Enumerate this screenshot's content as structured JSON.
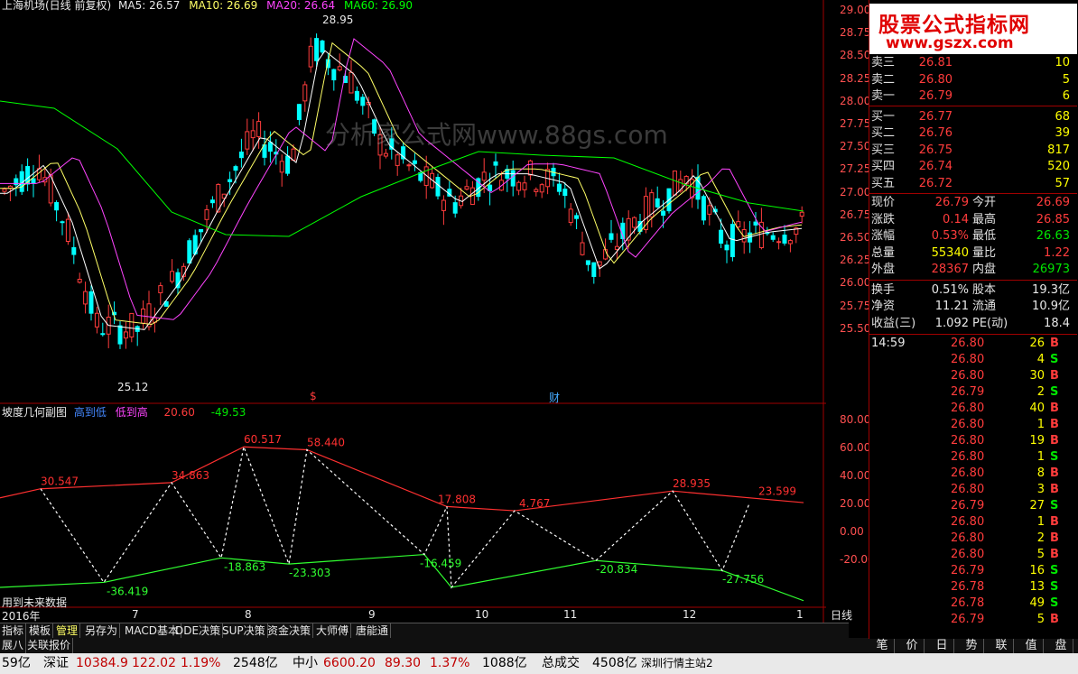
{
  "header": {
    "title": "上海机场(日线 前复权)",
    "ma5_label": "MA5: 26.57",
    "ma10_label": "MA10: 26.69",
    "ma20_label": "MA20: 26.64",
    "ma60_label": "MA60: 26.90"
  },
  "price_axis": [
    "29.00",
    "28.75",
    "28.50",
    "28.25",
    "28.00",
    "27.75",
    "27.50",
    "27.25",
    "27.00",
    "26.75",
    "26.50",
    "26.25",
    "26.00",
    "25.75",
    "25.50"
  ],
  "price_annotations": {
    "high": "28.95",
    "low": "25.12",
    "finance_marker": "财",
    "dollar_marker": "$"
  },
  "watermark_text": "分析家公式网www.88gs.com",
  "indicator": {
    "title": "坡度几何副图",
    "low_to_high": "高到低",
    "high_to_low": "低到高",
    "value1": "20.60",
    "value2": "-49.53",
    "axis": [
      "80.00",
      "60.00",
      "40.00",
      "20.00",
      "0.00",
      "-20.00"
    ],
    "labels": [
      "30.547",
      "34.863",
      "60.517",
      "58.440",
      "17.808",
      "4.767",
      "28.935",
      "23.599",
      "-36.419",
      "-18.863",
      "-23.303",
      "-16.459",
      "-20.834",
      "-27.756"
    ],
    "future_note": "用到未来数据"
  },
  "date_axis": [
    "2016年",
    "7",
    "8",
    "9",
    "10",
    "11",
    "12",
    "1"
  ],
  "watermark_logo": {
    "line1": "股票公式指标网",
    "line2": "www.gszx.com"
  },
  "orderbook": [
    {
      "label": "卖三",
      "price": "26.81",
      "vol": "10"
    },
    {
      "label": "卖二",
      "price": "26.80",
      "vol": "5"
    },
    {
      "label": "卖一",
      "price": "26.79",
      "vol": "6"
    },
    {
      "label": "买一",
      "price": "26.77",
      "vol": "68"
    },
    {
      "label": "买二",
      "price": "26.76",
      "vol": "39"
    },
    {
      "label": "买三",
      "price": "26.75",
      "vol": "817"
    },
    {
      "label": "买四",
      "price": "26.74",
      "vol": "520"
    },
    {
      "label": "买五",
      "price": "26.72",
      "vol": "57"
    }
  ],
  "stats": [
    {
      "l1": "现价",
      "v1": "26.79",
      "l2": "今开",
      "v2": "26.69"
    },
    {
      "l1": "涨跌",
      "v1": "0.14",
      "l2": "最高",
      "v2": "26.85"
    },
    {
      "l1": "涨幅",
      "v1": "0.53%",
      "l2": "最低",
      "v2": "26.63"
    },
    {
      "l1": "总量",
      "v1": "55340",
      "l2": "量比",
      "v2": "1.22"
    },
    {
      "l1": "外盘",
      "v1": "28367",
      "l2": "内盘",
      "v2": "26973"
    },
    {
      "l1": "换手",
      "v1": "0.51%",
      "l2": "股本",
      "v2": "19.3亿"
    },
    {
      "l1": "净资",
      "v1": "11.21",
      "l2": "流通",
      "v2": "10.9亿"
    },
    {
      "l1": "收益(三)",
      "v1": "1.092",
      "l2": "PE(动)",
      "v2": "18.4"
    }
  ],
  "ticks": [
    {
      "t": "14:59",
      "p": "26.80",
      "v": "26",
      "bs": "B"
    },
    {
      "t": "",
      "p": "26.80",
      "v": "4",
      "bs": "S"
    },
    {
      "t": "",
      "p": "26.80",
      "v": "30",
      "bs": "B"
    },
    {
      "t": "",
      "p": "26.79",
      "v": "2",
      "bs": "S"
    },
    {
      "t": "",
      "p": "26.80",
      "v": "40",
      "bs": "B"
    },
    {
      "t": "",
      "p": "26.80",
      "v": "1",
      "bs": "B"
    },
    {
      "t": "",
      "p": "26.80",
      "v": "19",
      "bs": "B"
    },
    {
      "t": "",
      "p": "26.80",
      "v": "1",
      "bs": "S"
    },
    {
      "t": "",
      "p": "26.80",
      "v": "8",
      "bs": "B"
    },
    {
      "t": "",
      "p": "26.80",
      "v": "3",
      "bs": "B"
    },
    {
      "t": "",
      "p": "26.79",
      "v": "27",
      "bs": "S"
    },
    {
      "t": "",
      "p": "26.80",
      "v": "1",
      "bs": "B"
    },
    {
      "t": "",
      "p": "26.80",
      "v": "2",
      "bs": "B"
    },
    {
      "t": "",
      "p": "26.80",
      "v": "5",
      "bs": "B"
    },
    {
      "t": "",
      "p": "26.79",
      "v": "16",
      "bs": "S"
    },
    {
      "t": "",
      "p": "26.78",
      "v": "13",
      "bs": "S"
    },
    {
      "t": "",
      "p": "26.78",
      "v": "49",
      "bs": "S"
    },
    {
      "t": "",
      "p": "26.79",
      "v": "5",
      "bs": "B"
    }
  ],
  "tabs": [
    "指标",
    "模板",
    "管理",
    "另存为",
    "MACD基本",
    "DDE决策",
    "SUP决策",
    "资金决策",
    "大师傅",
    "唐能通"
  ],
  "period_label": "日线",
  "subtabs": [
    "展八",
    "关联报价"
  ],
  "right_tabs": [
    "笔",
    "价",
    "日",
    "势",
    "联",
    "值",
    "盘"
  ],
  "status": {
    "s1": "59亿",
    "s2": "深证",
    "s3": "10384.9",
    "s4": "122.02",
    "s5": "1.19%",
    "s6": "2548亿",
    "s7": "中小",
    "s8": "6600.20",
    "s9": "89.30",
    "s10": "1.37%",
    "s11": "1088亿",
    "s12": "总成交",
    "s13": "4508亿",
    "s14": "深圳行情主站2"
  }
}
